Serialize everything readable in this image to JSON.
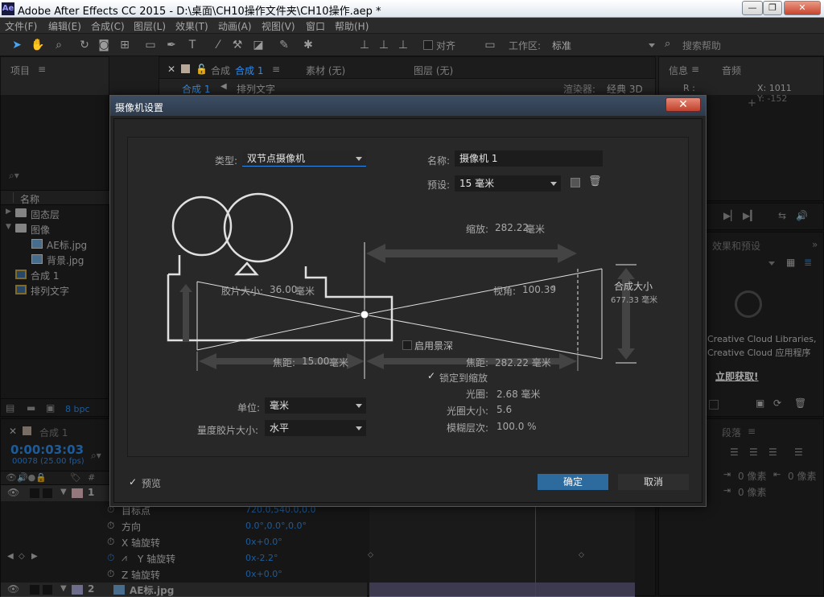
{
  "window": {
    "app_icon": "Ae",
    "title": "Adobe After Effects CC 2015 - D:\\桌面\\CH10操作文件夹\\CH10操作.aep *",
    "minimize": "—",
    "maximize": "❐",
    "close": "✕"
  },
  "menu": [
    "文件(F)",
    "编辑(E)",
    "合成(C)",
    "图层(L)",
    "效果(T)",
    "动画(A)",
    "视图(V)",
    "窗口",
    "帮助(H)"
  ],
  "toolbar": {
    "align_label": "对齐",
    "workspace_label": "工作区:",
    "workspace_value": "标准",
    "search_placeholder": "搜索帮助"
  },
  "project_panel": {
    "tab": "项目",
    "col_name": "名称",
    "items": [
      {
        "name": "固态层",
        "type": "folder",
        "indent": 0
      },
      {
        "name": "图像",
        "type": "folder",
        "indent": 0
      },
      {
        "name": "AE标.jpg",
        "type": "image",
        "indent": 1
      },
      {
        "name": "背景.jpg",
        "type": "image",
        "indent": 1
      },
      {
        "name": "合成 1",
        "type": "comp",
        "indent": 0
      },
      {
        "name": "排列文字",
        "type": "comp",
        "indent": 0
      }
    ],
    "bpc": "8 bpc"
  },
  "comp_panel": {
    "tab_prefix": "合成",
    "tab_name": "合成 1",
    "footage_tab": "素材 (无)",
    "layer_tab": "图层 (无)",
    "breadcrumb_1": "合成 1",
    "breadcrumb_2": "排列文字",
    "renderer_label": "渲染器:",
    "renderer_value": "经典 3D"
  },
  "info_panel": {
    "tab_info": "信息",
    "tab_audio": "音频",
    "r_label": "R :",
    "x": "X: 1011",
    "y": "Y: -152"
  },
  "effects_panel": {
    "tab": "效果和预设",
    "cc_line1": "Creative Cloud Libraries,",
    "cc_line2": "Creative Cloud 应用程序",
    "get_now": "立即获取!"
  },
  "paragraph_panel": {
    "tab": "段落",
    "indent1": "0 像素",
    "indent2": "0 像素",
    "indent3": "0 像素"
  },
  "timeline": {
    "tab": "合成 1",
    "timecode": "0:00:03:03",
    "frames": "00078 (25.00 fps)",
    "layer1_num": "1",
    "layer2_num": "2",
    "layer2_name": "AE标.jpg",
    "props": [
      {
        "name": "目标点",
        "value": "720.0,540.0,0.0"
      },
      {
        "name": "方向",
        "value": "0.0°,0.0°,0.0°"
      },
      {
        "name": "X 轴旋转",
        "value": "0x+0.0°"
      },
      {
        "name": "Y 轴旋转",
        "value": "0x-2.2°"
      },
      {
        "name": "Z 轴旋转",
        "value": "0x+0.0°"
      }
    ]
  },
  "dialog": {
    "title": "摄像机设置",
    "close": "✕",
    "type_label": "类型:",
    "type_value": "双节点摄像机",
    "name_label": "名称:",
    "name_value": "摄像机 1",
    "preset_label": "预设:",
    "preset_value": "15 毫米",
    "zoom_label": "缩放:",
    "zoom_value": "282.22",
    "zoom_unit": "毫米",
    "film_label": "胶片大小:",
    "film_value": "36.00",
    "film_unit": "毫米",
    "angle_label": "视角:",
    "angle_value": "100.39",
    "angle_unit": "°",
    "comp_size_label": "合成大小",
    "comp_size_value": "677.33 毫米",
    "focal_label": "焦距:",
    "focal_value": "15.00",
    "focal_unit": "毫米",
    "dof_label": "启用景深",
    "focus_dist_label": "焦距:",
    "focus_dist_value": "282.22 毫米",
    "lock_label": "锁定到缩放",
    "aperture_label": "光圈:",
    "aperture_value": "2.68 毫米",
    "fstop_label": "光圈大小:",
    "fstop_value": "5.6",
    "blur_label": "模糊层次:",
    "blur_value": "100.0 %",
    "units_label": "单位:",
    "units_value": "毫米",
    "measure_label": "量度胶片大小:",
    "measure_value": "水平",
    "preview_label": "预览",
    "ok": "确定",
    "cancel": "取消"
  }
}
